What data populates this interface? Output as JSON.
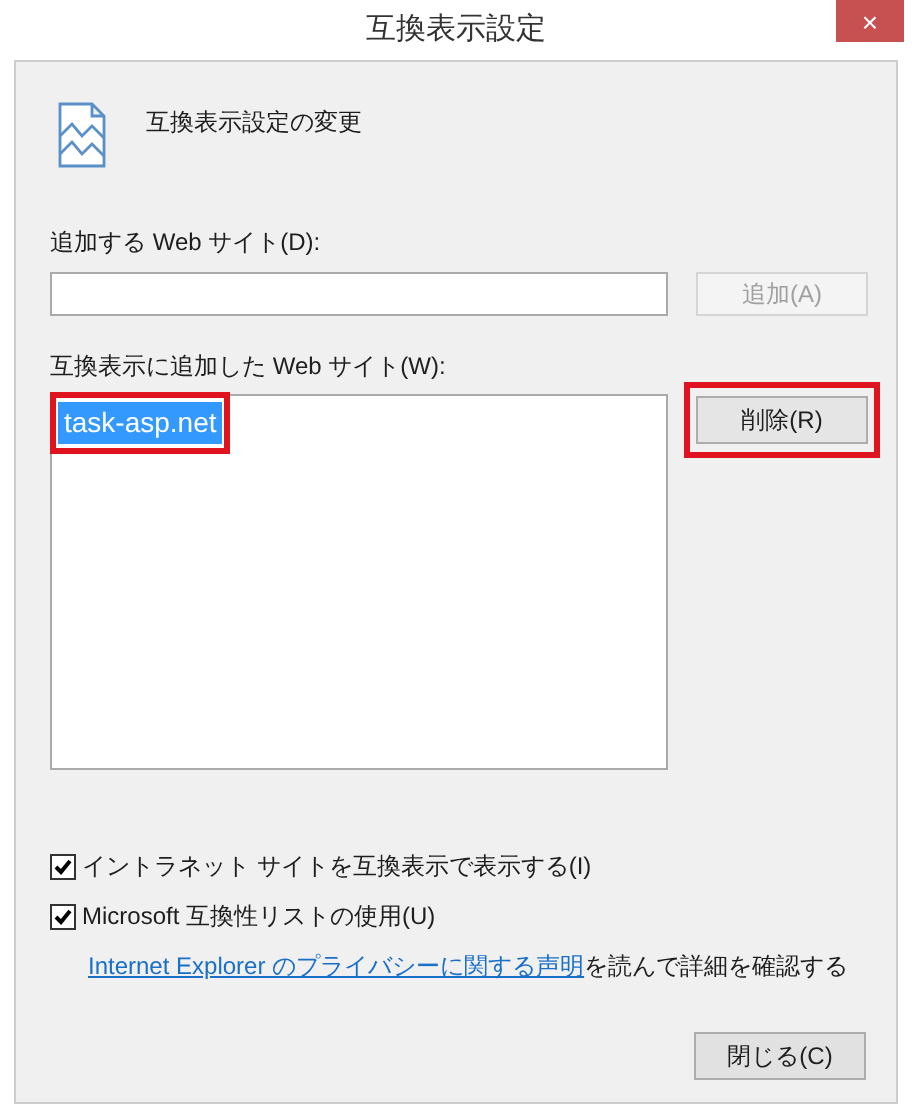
{
  "window": {
    "title": "互換表示設定",
    "close": "×"
  },
  "heading": "互換表示設定の変更",
  "add_site": {
    "label": "追加する Web サイト(D):",
    "button": {
      "label": "追加(A)",
      "disabled": true
    }
  },
  "sites": {
    "label": "互換表示に追加した Web サイト(W):",
    "items": [
      {
        "label": "task-asp.net",
        "selected": true,
        "annotated": true
      }
    ],
    "remove_button": {
      "label": "削除(R)",
      "annotated": true
    }
  },
  "options": [
    {
      "label": "イントラネット サイトを互換表示で表示する(I)",
      "checked": true
    },
    {
      "label": "Microsoft 互換性リストの使用(U)",
      "checked": true
    }
  ],
  "privacy": {
    "link": "Internet Explorer のプライバシーに関する声明",
    "text": "を読んで詳細を確認する"
  },
  "close_button": "閉じる(C)"
}
